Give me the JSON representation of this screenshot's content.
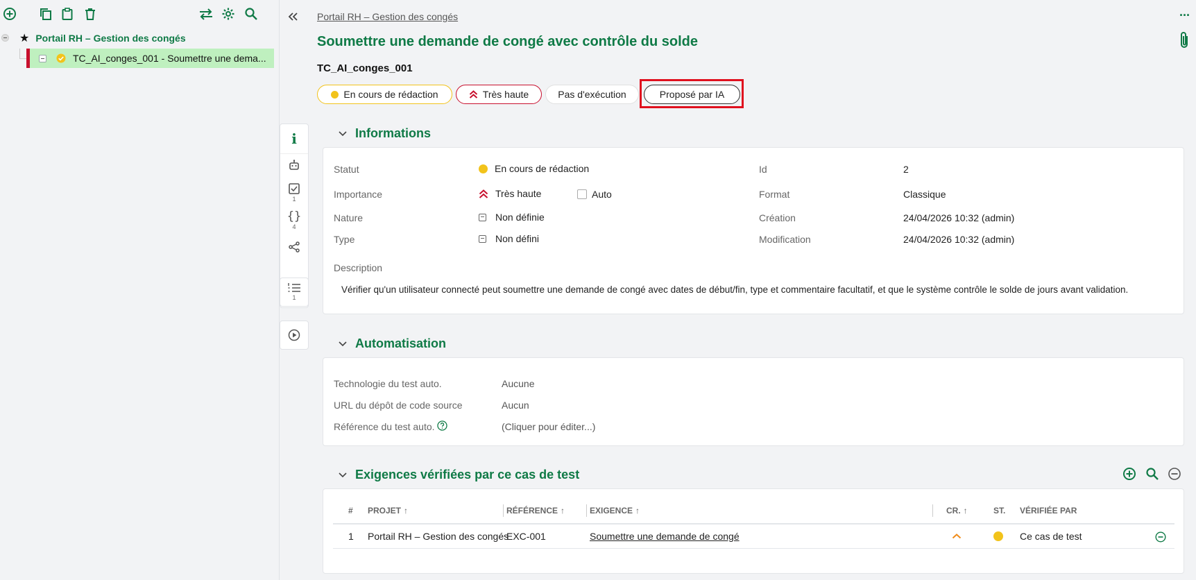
{
  "tree": {
    "project_label": "Portail RH – Gestion des congés",
    "testcase_label": "TC_AI_conges_001 - Soumettre une dema..."
  },
  "header": {
    "breadcrumb": "Portail RH – Gestion des congés",
    "title": "Soumettre une demande de congé avec contrôle du solde",
    "reference": "TC_AI_conges_001",
    "more_label": "···"
  },
  "badges": {
    "status": "En cours de rédaction",
    "importance": "Très haute",
    "execution": "Pas d'exécution",
    "ai": "Proposé par IA"
  },
  "rail": {
    "requirements_count": "1",
    "parameters_count": "4",
    "steps_count": "1"
  },
  "informations": {
    "heading": "Informations",
    "statut_label": "Statut",
    "statut_value": "En cours de rédaction",
    "importance_label": "Importance",
    "importance_value": "Très haute",
    "auto_label": "Auto",
    "nature_label": "Nature",
    "nature_value": "Non définie",
    "type_label": "Type",
    "type_value": "Non défini",
    "id_label": "Id",
    "id_value": "2",
    "format_label": "Format",
    "format_value": "Classique",
    "creation_label": "Création",
    "creation_value": "24/04/2026 10:32 (admin)",
    "modification_label": "Modification",
    "modification_value": "24/04/2026 10:32 (admin)",
    "description_label": "Description",
    "description_value": "Vérifier qu'un utilisateur connecté peut soumettre une demande de congé avec dates de début/fin, type et commentaire facultatif, et que le système contrôle le solde de jours avant validation."
  },
  "automatisation": {
    "heading": "Automatisation",
    "tech_label": "Technologie du test auto.",
    "tech_value": "Aucune",
    "url_label": "URL du dépôt de code source",
    "url_value": "Aucun",
    "ref_label": "Référence du test auto.",
    "ref_value": "(Cliquer pour éditer...)"
  },
  "exigences": {
    "heading": "Exigences vérifiées par ce cas de test",
    "columns": {
      "num": "#",
      "projet": "PROJET",
      "reference": "RÉFÉRENCE",
      "exigence": "EXIGENCE",
      "cr": "CR.",
      "st": "ST.",
      "verifiee": "VÉRIFIÉE PAR"
    },
    "rows": [
      {
        "num": "1",
        "projet": "Portail RH – Gestion des congés",
        "reference": "EXC-001",
        "exigence": "Soumettre une demande de congé",
        "verifiee": "Ce cas de test"
      }
    ]
  },
  "colors": {
    "accent_green": "#0f7a46",
    "status_yellow": "#f2c31b",
    "importance_red": "#c8102e",
    "highlight_red": "#e0101e",
    "selection_green": "#bff0bf"
  }
}
